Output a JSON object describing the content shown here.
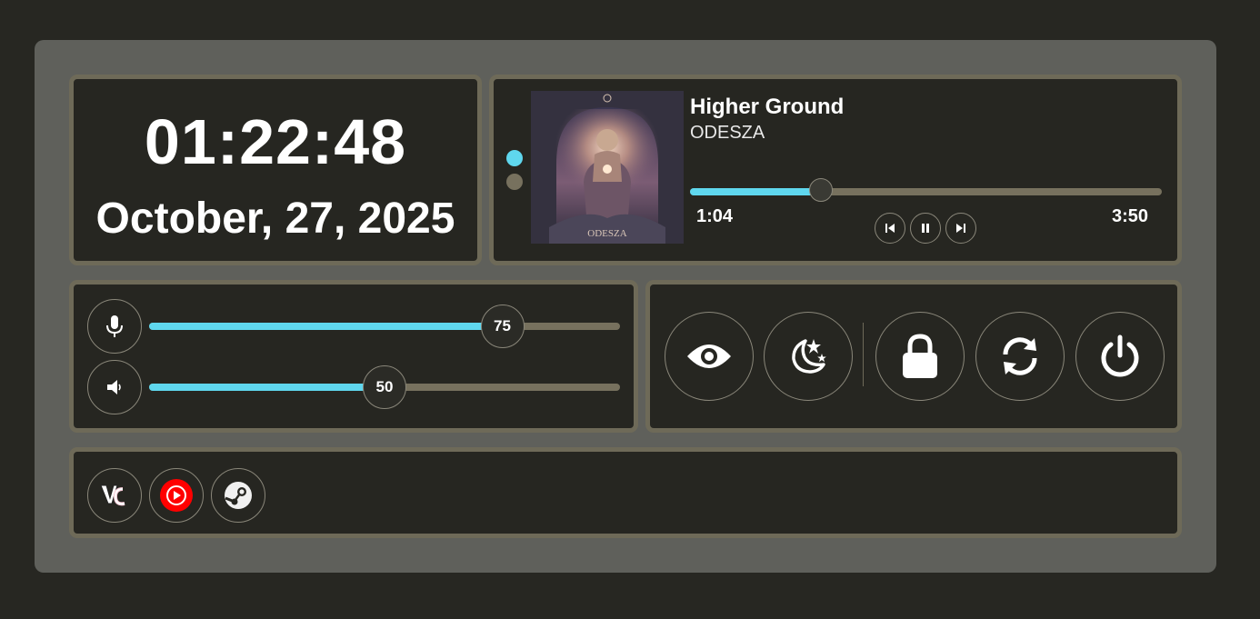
{
  "clock": {
    "time": "01:22:48",
    "date": "October, 27, 2025"
  },
  "player": {
    "title": "Higher Ground",
    "artist": "ODESZA",
    "elapsed": "1:04",
    "duration": "3:50",
    "progress": 0.2783,
    "album_art_text": "ODESZA",
    "album_art_icon": "album-art",
    "page_indicator_active_color": "#5fd7ee",
    "page_indicator_inactive_color": "#77715e",
    "controls": [
      "previous-icon",
      "pause-icon",
      "next-icon"
    ]
  },
  "audio": {
    "microphone": {
      "icon": "microphone-icon",
      "value": "75",
      "level": 0.75
    },
    "speaker": {
      "icon": "speaker-icon",
      "value": "50",
      "level": 0.5
    }
  },
  "system_actions": [
    "eye-icon",
    "night-mode-icon",
    "lock-icon",
    "restart-icon",
    "power-icon"
  ],
  "apps": [
    "vencord-icon",
    "youtube-music-icon",
    "steam-icon"
  ],
  "colors": {
    "background": "#272722",
    "panel": "#5f605b",
    "card": "#262621",
    "card_border": "#6e6a58",
    "accent": "#5fd7ee",
    "track": "#77715e"
  }
}
